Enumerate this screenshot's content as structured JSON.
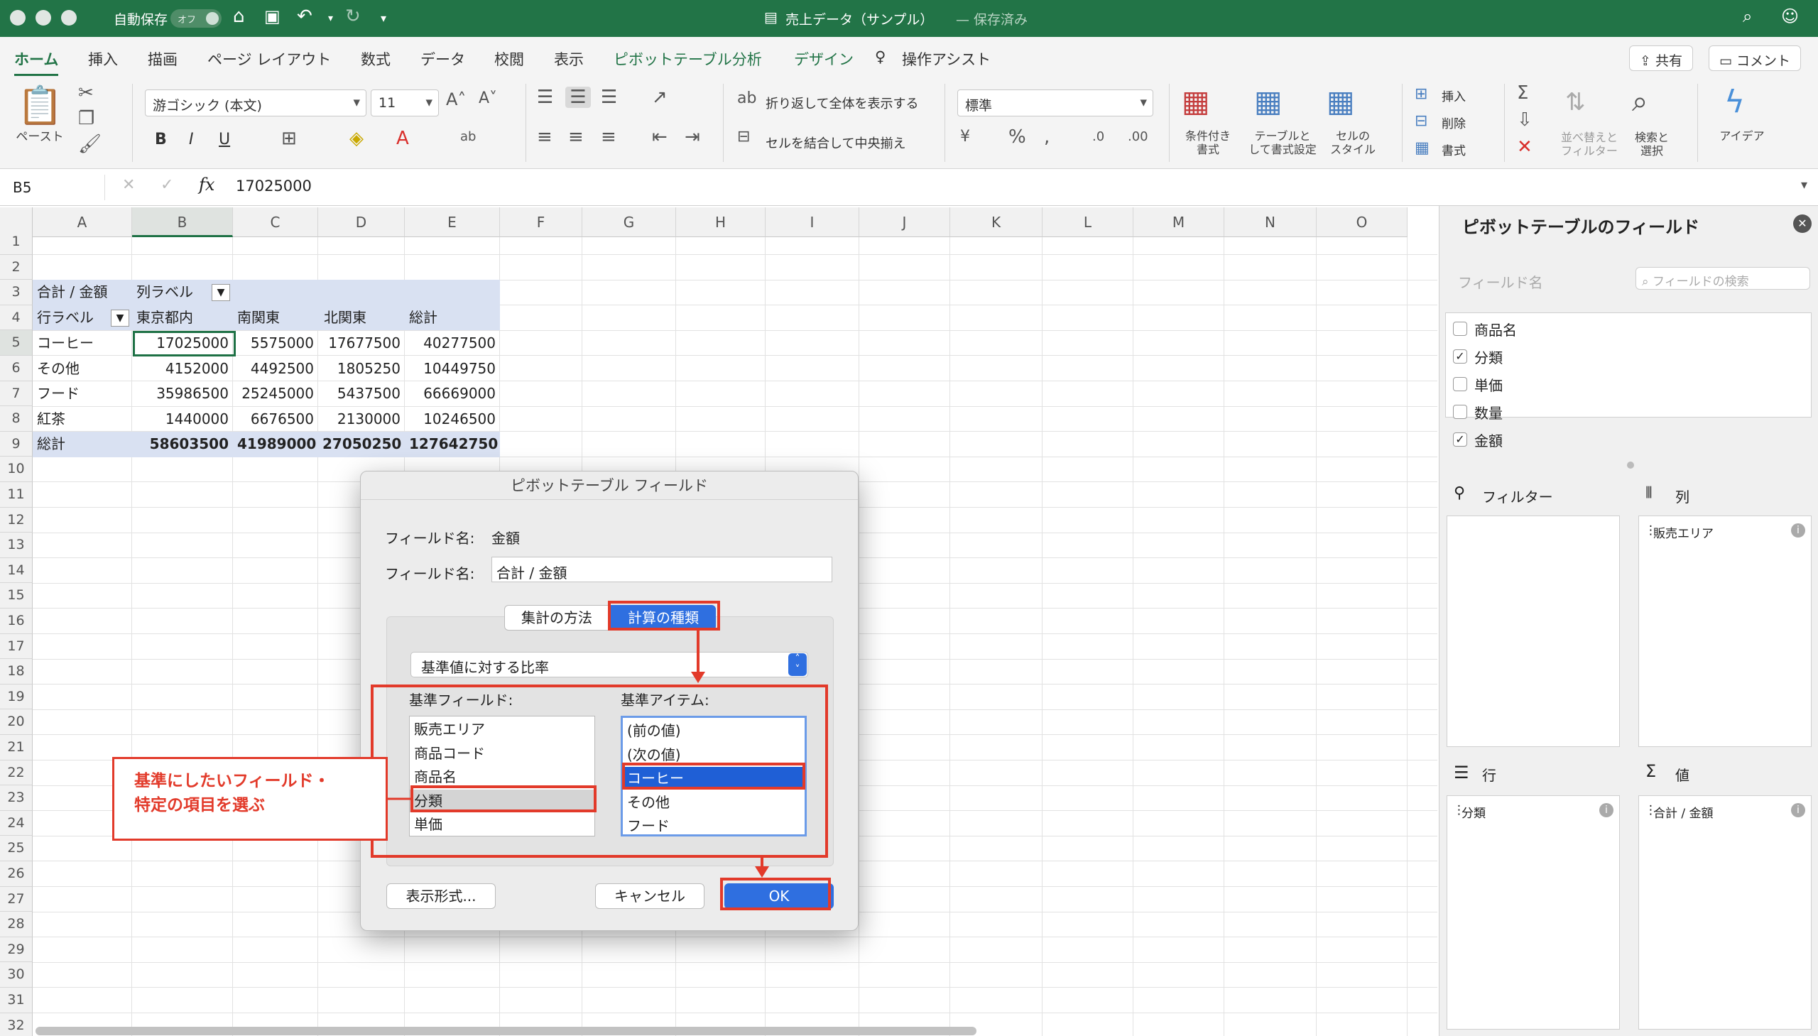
{
  "titlebar": {
    "autosave_label": "自動保存",
    "autosave_state": "オフ",
    "title": "売上データ（サンプル）",
    "saved": "— 保存済み"
  },
  "tabs": [
    "ホーム",
    "挿入",
    "描画",
    "ページ レイアウト",
    "数式",
    "データ",
    "校閲",
    "表示",
    "ピボットテーブル分析",
    "デザイン",
    "操作アシスト"
  ],
  "share_label": "共有",
  "comment_label": "コメント",
  "ribbon": {
    "paste": "ペースト",
    "font_name": "游ゴシック (本文)",
    "font_size": "11",
    "wrap": "折り返して全体を表示する",
    "merge": "セルを結合して中央揃え",
    "number_format": "標準",
    "cond_format": "条件付き\n書式",
    "table_format": "テーブルと\nして書式設定",
    "cell_style": "セルの\nスタイル",
    "insert": "挿入",
    "delete": "削除",
    "format": "書式",
    "sort_filter": "並べ替えと\nフィルター",
    "find_select": "検索と\n選択",
    "ideas": "アイデア",
    "bold": "B",
    "italic": "I",
    "underline": "U"
  },
  "formula_bar": {
    "cell_ref": "B5",
    "fx": "fx",
    "value": "17025000"
  },
  "columns": [
    "A",
    "B",
    "C",
    "D",
    "E",
    "F",
    "G",
    "H",
    "I",
    "J",
    "K",
    "L",
    "M",
    "N",
    "O"
  ],
  "rows": [
    "1",
    "2",
    "3",
    "4",
    "5",
    "6",
    "7",
    "8",
    "9",
    "10",
    "11",
    "12",
    "13",
    "14",
    "15",
    "16",
    "17",
    "18",
    "19",
    "20",
    "21",
    "22",
    "23",
    "24",
    "25",
    "26",
    "27",
    "28",
    "29",
    "30",
    "31",
    "32"
  ],
  "pivot": {
    "r3": {
      "a": "合計 / 金額",
      "b": "列ラベル"
    },
    "r4": {
      "a": "行ラベル",
      "b": "東京都内",
      "c": "南関東",
      "d": "北関東",
      "e": "総計"
    },
    "data": [
      {
        "label": "コーヒー",
        "b": "17025000",
        "c": "5575000",
        "d": "17677500",
        "e": "40277500"
      },
      {
        "label": "その他",
        "b": "4152000",
        "c": "4492500",
        "d": "1805250",
        "e": "10449750"
      },
      {
        "label": "フード",
        "b": "35986500",
        "c": "25245000",
        "d": "5437500",
        "e": "66669000"
      },
      {
        "label": "紅茶",
        "b": "1440000",
        "c": "6676500",
        "d": "2130000",
        "e": "10246500"
      }
    ],
    "total": {
      "label": "総計",
      "b": "58603500",
      "c": "41989000",
      "d": "27050250",
      "e": "127642750"
    }
  },
  "pane": {
    "title": "ピボットテーブルのフィールド",
    "field_name_label": "フィールド名",
    "search_placeholder": "フィールドの検索",
    "fields": [
      {
        "name": "商品名",
        "checked": false
      },
      {
        "name": "分類",
        "checked": true
      },
      {
        "name": "単価",
        "checked": false
      },
      {
        "name": "数量",
        "checked": false
      },
      {
        "name": "金額",
        "checked": true
      }
    ],
    "filter_label": "フィルター",
    "columns_label": "列",
    "rows_label": "行",
    "values_label": "値",
    "columns_item": "販売エリア",
    "rows_item": "分類",
    "values_item": "合計 / 金額"
  },
  "dialog": {
    "title": "ピボットテーブル フィールド",
    "field_name_label": "フィールド名:",
    "field_name_value": "金額",
    "custom_name_label": "フィールド名:",
    "custom_name_value": "合計 / 金額",
    "tab_summarize": "集計の方法",
    "tab_calc": "計算の種類",
    "calc_type": "基準値に対する比率",
    "base_field_label": "基準フィールド:",
    "base_item_label": "基準アイテム:",
    "base_fields": [
      "販売エリア",
      "商品コード",
      "商品名",
      "分類",
      "単価"
    ],
    "base_items": [
      "(前の値)",
      "(次の値)",
      "コーヒー",
      "その他",
      "フード"
    ],
    "format_button": "表示形式...",
    "cancel_button": "キャンセル",
    "ok_button": "OK"
  },
  "callout": {
    "line1": "基準にしたいフィールド・",
    "line2": "特定の項目を選ぶ"
  },
  "colors": {
    "excel_green": "#227447",
    "annotation_red": "#e23a2a",
    "select_blue": "#1f5fd6"
  }
}
